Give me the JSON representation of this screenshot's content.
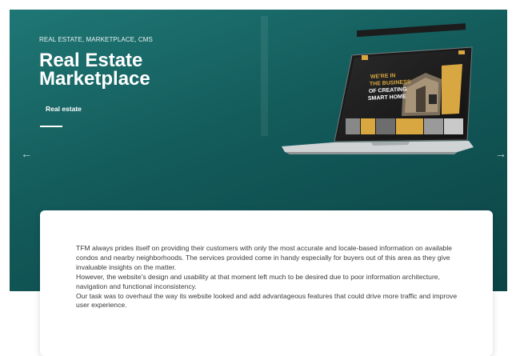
{
  "hero": {
    "tags": "REAL ESTATE, MARKETPLACE, CMS",
    "title_line1": "Real Estate",
    "title_line2": "Marketplace",
    "subtitle": "Real estate"
  },
  "laptop_screen": {
    "headline_1": "WE'RE IN",
    "headline_2": "THE BUSINESS",
    "headline_3": "OF CREATING",
    "headline_4": "SMART HOME"
  },
  "navigation": {
    "prev_icon": "arrow-left-icon",
    "next_icon": "arrow-right-icon"
  },
  "description": {
    "paragraphs": [
      "TFM always prides itself on providing their customers with only the most accurate and locale-based information on available condos and nearby neighborhoods. The services provided come in handy especially for buyers out of this area as they give invaluable insights on the matter.",
      "However, the website's design and usability at that moment left much to be desired due to poor information architecture, navigation and functional inconsistency.",
      "Our task was to overhaul the way its website looked and add advantageous features that could drive more traffic and improve user experience."
    ]
  },
  "colors": {
    "hero_bg": "#135a5a",
    "accent": "#d9a741",
    "text": "#3a3a3a"
  }
}
